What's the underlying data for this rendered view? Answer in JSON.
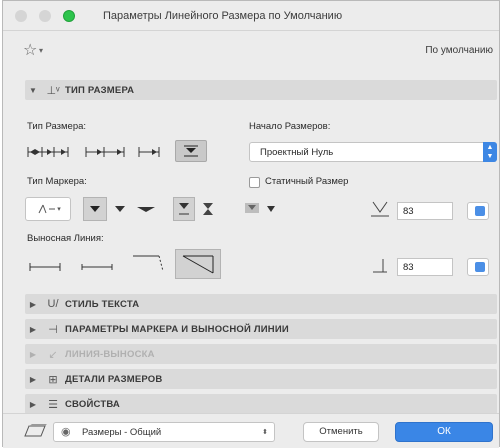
{
  "window": {
    "title": "Параметры Линейного Размера по Умолчанию"
  },
  "favorites": {
    "default_label": "По умолчанию"
  },
  "sections": {
    "dim_type": "ТИП РАЗМЕРА",
    "text_style": "СТИЛЬ ТЕКСТА",
    "marker_params": "ПАРАМЕТРЫ МАРКЕРА И ВЫНОСНОЙ ЛИНИИ",
    "leader": "ЛИНИЯ-ВЫНОСКА",
    "details": "ДЕТАЛИ РАЗМЕРОВ",
    "properties": "СВОЙСТВА"
  },
  "dim_type": {
    "type_label": "Тип Размера:",
    "origin_label": "Начало Размеров:",
    "origin_value": "Проектный Нуль",
    "marker_label": "Тип Маркера:",
    "static_label": "Статичный Размер",
    "witness_label": "Выносная Линия:",
    "marker_size_value": "83",
    "witness_gap_value": "83"
  },
  "bottom": {
    "layer_value": "Размеры - Общий",
    "cancel_label": "Отменить",
    "ok_label": "ОК"
  },
  "colors": {
    "accent": "#3a86e6",
    "titlebar_green": "#2dc44c"
  },
  "icons": {
    "favorites": "star-icon",
    "layer_visibility": "eye-icon"
  }
}
